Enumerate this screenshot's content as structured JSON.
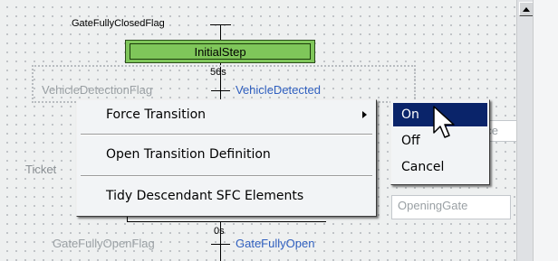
{
  "diagram": {
    "top_flag": "GateFullyClosedFlag",
    "initial_step": "InitialStep",
    "timer_top": "56s",
    "transition_condition": "VehicleDetectionFlag",
    "transition_name": "VehicleDetected",
    "partial_box_right": "nce",
    "ticket_label": "Ticket",
    "opening_gate": "OpeningGate",
    "timer_bottom": "0s",
    "bottom_condition": "GateFullyOpenFlag",
    "bottom_transition": "GateFullyOpen"
  },
  "context_menu": {
    "items": [
      {
        "label": "Force Transition",
        "has_submenu": true
      },
      {
        "label": "Open Transition Definition"
      },
      {
        "label": "Tidy Descendant SFC Elements"
      }
    ]
  },
  "submenu": {
    "items": [
      {
        "label": "On",
        "selected": true
      },
      {
        "label": "Off"
      },
      {
        "label": "Cancel"
      }
    ]
  }
}
